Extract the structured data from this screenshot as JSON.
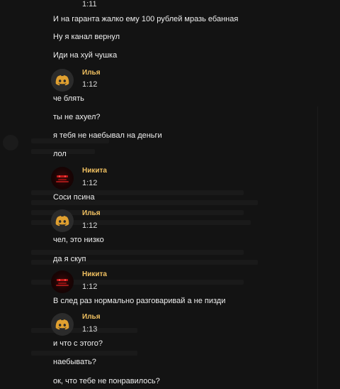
{
  "messages": {
    "top_time": "1:11",
    "line1": "И на гаранта жалко ему 100 рублей мразь ебанная",
    "line2": "Ну я канал вернул",
    "line3": "Иди на хуй чушка"
  },
  "groups": [
    {
      "author": "Илья",
      "time": "1:12",
      "avatar_icon": "discord-icon",
      "lines": [
        "че блять",
        "ты не ахуел?",
        "я тебя не наебывал на деньги",
        "лол"
      ]
    },
    {
      "author": "Никита",
      "time": "1:12",
      "avatar_icon": "red-mask-icon",
      "lines": [
        "Соси псина"
      ]
    },
    {
      "author": "Илья",
      "time": "1:12",
      "avatar_icon": "discord-icon",
      "lines": [
        "чел, это низко",
        "да я скуп"
      ]
    },
    {
      "author": "Никита",
      "time": "1:12",
      "avatar_icon": "red-mask-icon",
      "lines": [
        "В след раз нормально разговаривай а не пизди"
      ]
    },
    {
      "author": "Илья",
      "time": "1:13",
      "avatar_icon": "discord-icon",
      "lines": [
        "и что с этого?",
        "наебывать?",
        "ок, что тебе не понравилось?"
      ]
    }
  ],
  "colors": {
    "background": "#131313",
    "author_name": "#f0c060",
    "message_text": "#f0f0f0",
    "discord_avatar_logo": "#e0a030"
  }
}
